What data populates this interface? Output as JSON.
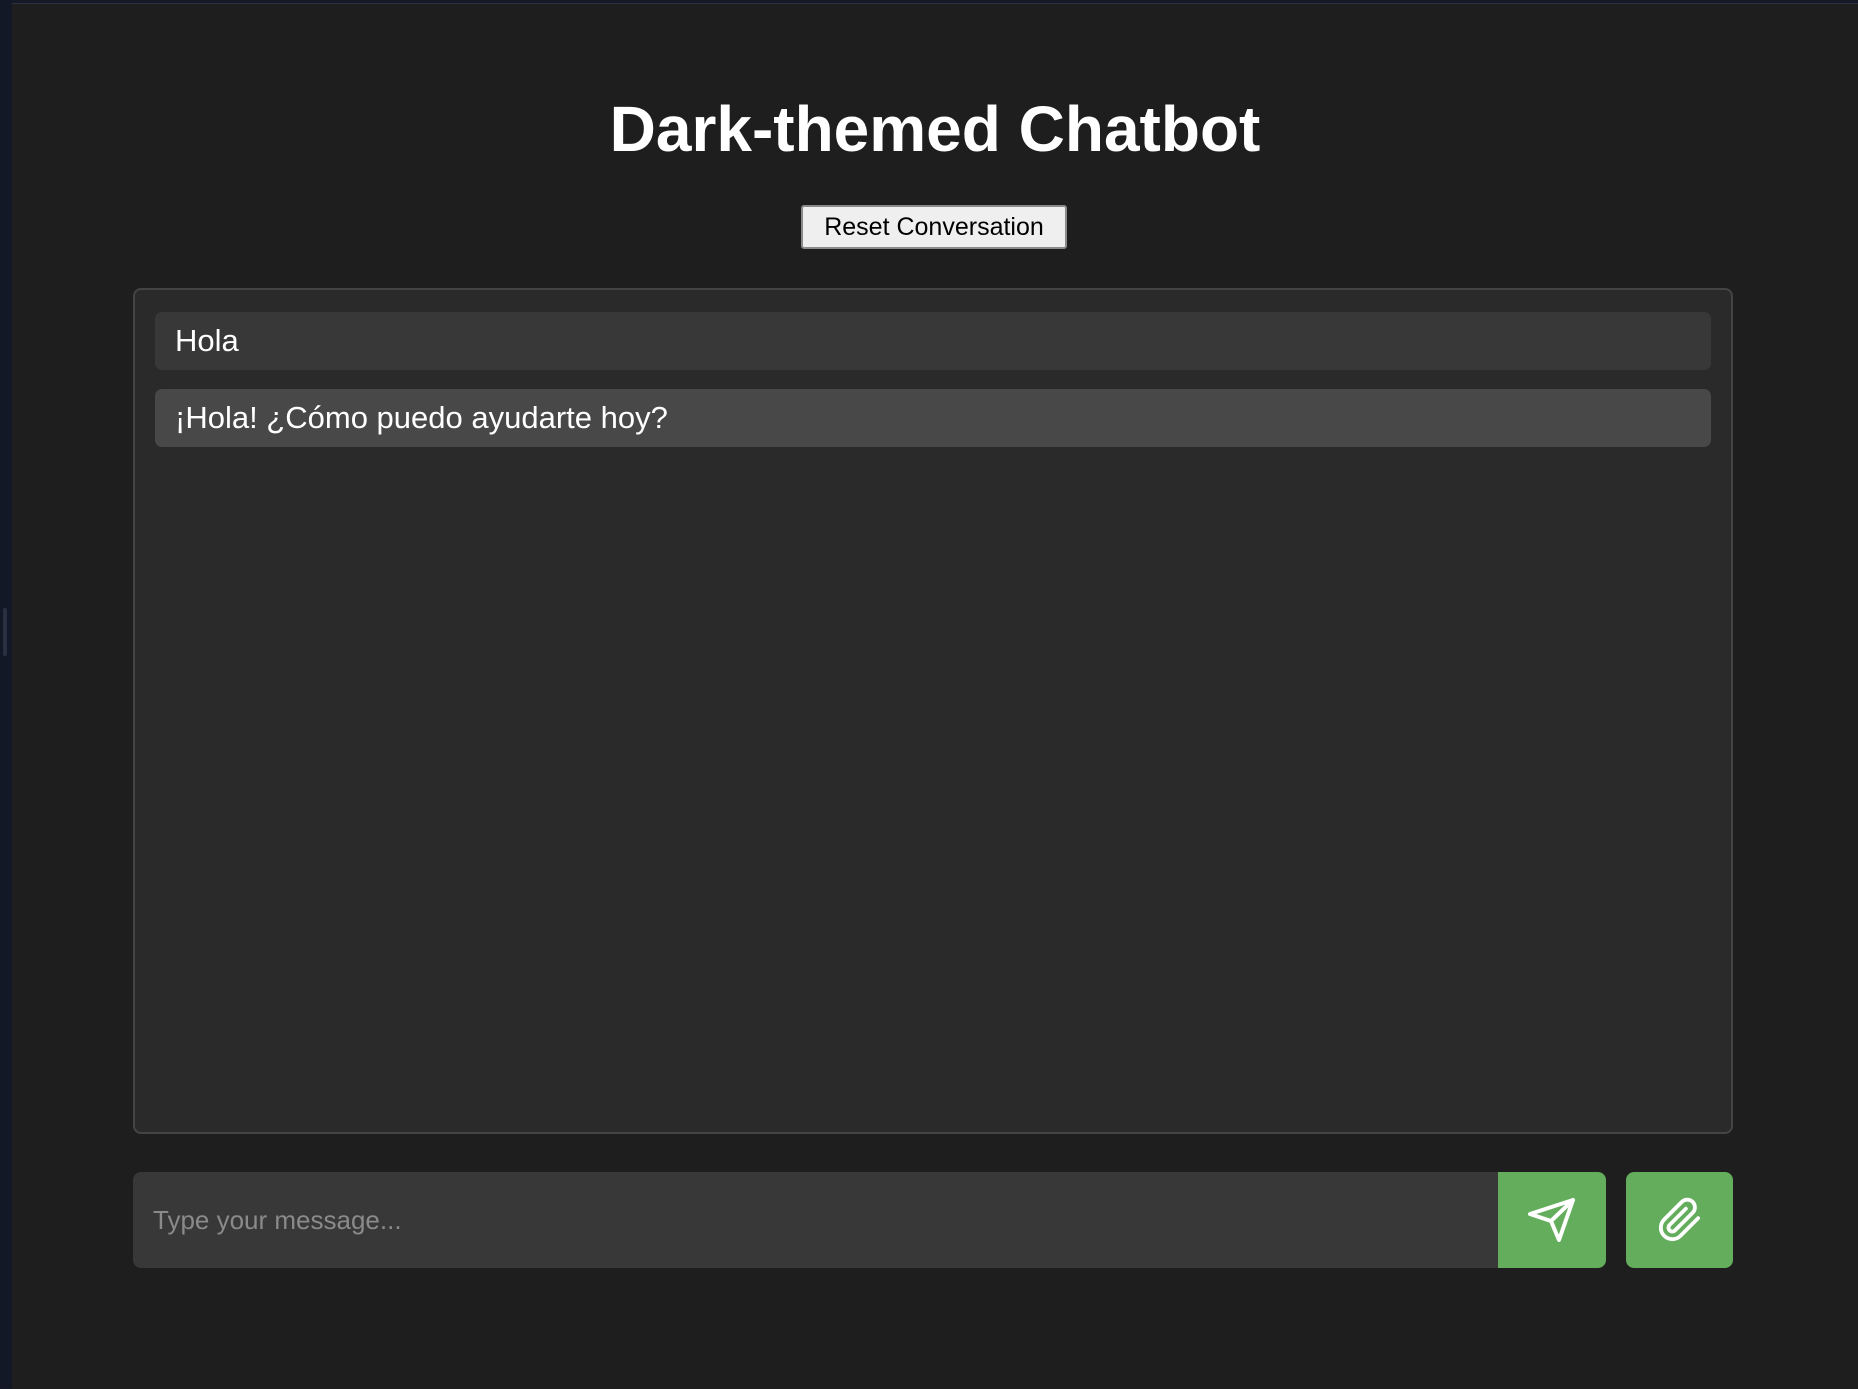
{
  "header": {
    "title": "Dark-themed Chatbot",
    "reset_label": "Reset Conversation"
  },
  "chat": {
    "messages": [
      {
        "role": "user",
        "text": "Hola"
      },
      {
        "role": "bot",
        "text": "¡Hola! ¿Cómo puedo ayudarte hoy?"
      }
    ]
  },
  "composer": {
    "placeholder": "Type your message...",
    "value": "",
    "send_icon": "send-icon",
    "attach_icon": "paperclip-icon"
  },
  "colors": {
    "background": "#1e1e1e",
    "chat_panel": "#2a2a2a",
    "user_bubble": "#383838",
    "bot_bubble": "#484848",
    "accent": "#63ad5c",
    "text": "#ffffff"
  }
}
